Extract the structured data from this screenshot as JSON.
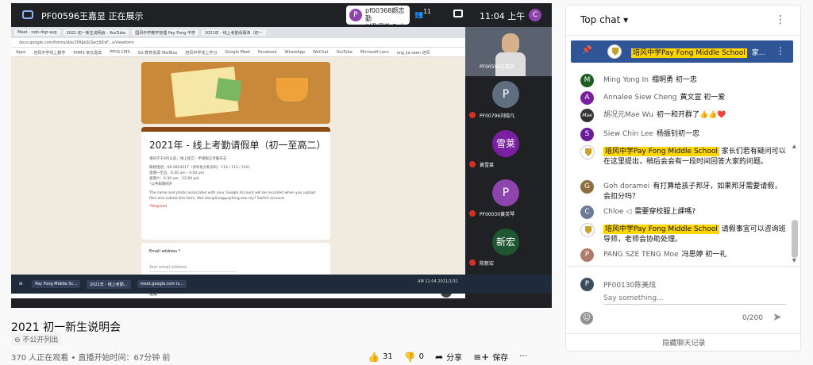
{
  "meet": {
    "presenter_label": "PF00596王嘉显 正在展示",
    "bubble_avatar": "P",
    "bubble_text_1": "pf00368颜志勤",
    "bubble_text_2": "以及另外 3 人",
    "people_count": "11",
    "time": "11:04 上午",
    "user_avatar": "C"
  },
  "browser": {
    "tabs": [
      "Meet - nqh-rkgr-ayg",
      "2021 初一新生说明会 - YouTube",
      "国风中学教学管理 Pay Fong 中学",
      "2021年 - 线上考勤请假单（初一"
    ],
    "address": "docs.google.com/forms/d/e/1FAIpQLSecJ9XvF...x/viewform",
    "bookmarks": [
      "Apps",
      "培风中学线上教学",
      "PHMS 家长嘉宾",
      "PFHS CMS",
      "SG 教育资源 MailBox",
      "培风中学线上学习",
      "Google Meet",
      "Facebook",
      "WhatsApp",
      "WeChat",
      "YouTube",
      "Microsoft Lens",
      "ong jia seen 培风"
    ]
  },
  "form": {
    "title": "2021年 - 线上考勤请假单（初一至高二）",
    "intro": "请同学于8点以前，线上提交 - 申请假正考勤日志 -",
    "contact": "联络电话：06-2824217（训导处分机号码：114 / 115 / 116）",
    "hours_1": "星期一至五：6:30 am - 4:00 pm",
    "hours_2": "星期六：6:30 am - 12:00 pm",
    "holiday": "*公共假期除外",
    "notice": "The name and photo associated with your Google Account will be recorded when you upload files and submit this form. Not discipline@payfong.edu.my? Switch account",
    "required": "*Required",
    "email_label": "Email address *",
    "email_placeholder": "Your email address",
    "class_label": "班级 *"
  },
  "taskbar": {
    "items": [
      "Pay Fong Middle Sc...",
      "2021年 - 线上考勤...",
      "meet.google.com is..."
    ],
    "tray": "AM 11:04 2021/1/31"
  },
  "participants": {
    "presenter": "PF00596王嘉显",
    "tiles": [
      {
        "avatar": "P",
        "name": "PF00796刘晓凡",
        "color": "#5f6f80"
      },
      {
        "avatar": "雪莱",
        "name": "黄雪莱",
        "color": "#7b1fa2"
      },
      {
        "avatar": "P",
        "name": "PF00030黄芙琴",
        "color": "#8e44ad"
      },
      {
        "avatar": "新宏",
        "name": "陈新宏",
        "color": "#1e5631"
      }
    ]
  },
  "video": {
    "title": "2021 初一新生说明会",
    "visibility": "不公开列出",
    "viewers": "370 人正在观看 • 直播开始时间：67分钟 前",
    "likes": "31",
    "dislikes": "0",
    "share": "分享",
    "save": "保存",
    "more": "···"
  },
  "chat": {
    "header": "Top chat",
    "pinned": {
      "author": "培风中学Pay Fong Middle School",
      "text": "家..."
    },
    "messages": [
      {
        "author": "Ming Yong In",
        "text": "禤明勇 初一忠",
        "avatar": "M",
        "color": "#1b5e20",
        "owner": false
      },
      {
        "author": "Annalee Siew Cheng",
        "text": "黄文宣 初一爱",
        "avatar": "A",
        "color": "#7b1fa2",
        "owner": false
      },
      {
        "author": "胡况元Mae Wu",
        "text": "初一和开群了👍👍❤️",
        "avatar": "Mae",
        "color": "#333333",
        "owner": false
      },
      {
        "author": "Siew Chin Lee",
        "text": "杨振钊初一忠",
        "avatar": "S",
        "color": "#6a1b9a",
        "owner": false
      },
      {
        "author": "培风中学Pay Fong Middle School",
        "text": "家长们若有疑问可以在这里提出，稍后会会有一段时间回答大家的问题。",
        "avatar": "",
        "color": "#ffffff",
        "owner": true
      },
      {
        "author": "Goh doramei",
        "text": "有打算给孩子邦牙，如果邦牙需要请假，会扣分吗？",
        "avatar": "G",
        "color": "#8d6e3f",
        "owner": false
      },
      {
        "author": "Chloe ◁",
        "text": "需要穿校服上課嗎?",
        "avatar": "C",
        "color": "#6d7b99",
        "owner": false
      },
      {
        "author": "培风中学Pay Fong Middle School",
        "text": "请假事宜可以咨询班导师，老师会协助处理。",
        "avatar": "",
        "color": "#ffffff",
        "owner": true
      },
      {
        "author": "PANG SZE TENG Moe",
        "text": "冯思婷 初一礼",
        "avatar": "P",
        "color": "#b07a6a",
        "owner": false
      }
    ],
    "self_avatar": "P",
    "self_name": "PF00130陈美炫",
    "input_placeholder": "Say something...",
    "char_count": "0/200",
    "hide_label": "隐藏聊天记录"
  }
}
